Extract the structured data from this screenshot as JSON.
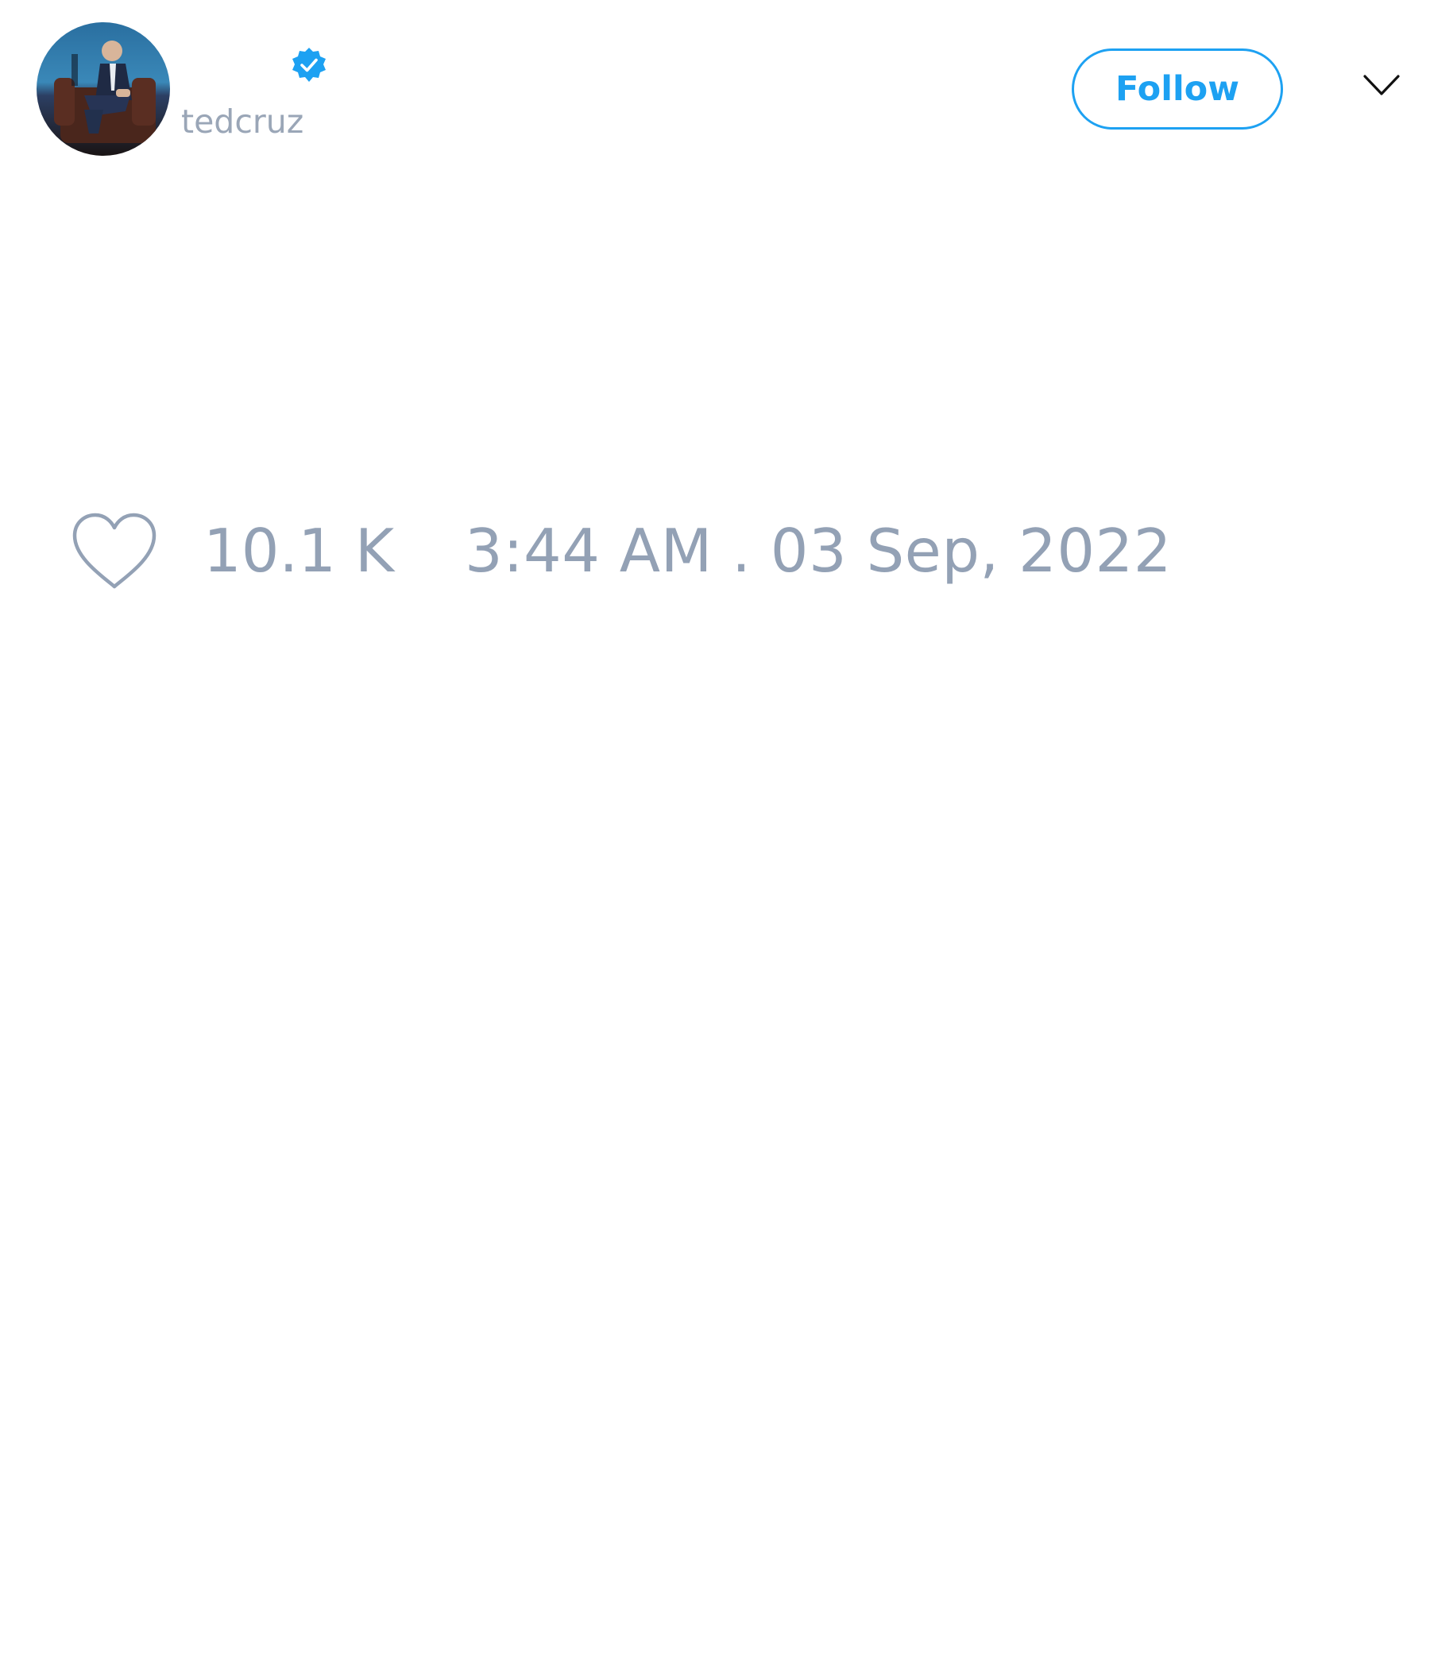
{
  "author": {
    "handle": "tedcruz",
    "verified": true,
    "avatar_icon": "profile-photo"
  },
  "header": {
    "follow_label": "Follow",
    "menu_icon": "chevron-down-icon"
  },
  "tweet": {
    "like_icon": "heart-outline-icon",
    "likes": "10.1 K",
    "timestamp": "3:44 AM . 03 Sep, 2022"
  },
  "colors": {
    "accent": "#1da1f2",
    "muted_text": "#93a1b5",
    "icon_stroke": "#93a1b5",
    "background": "#ffffff"
  }
}
